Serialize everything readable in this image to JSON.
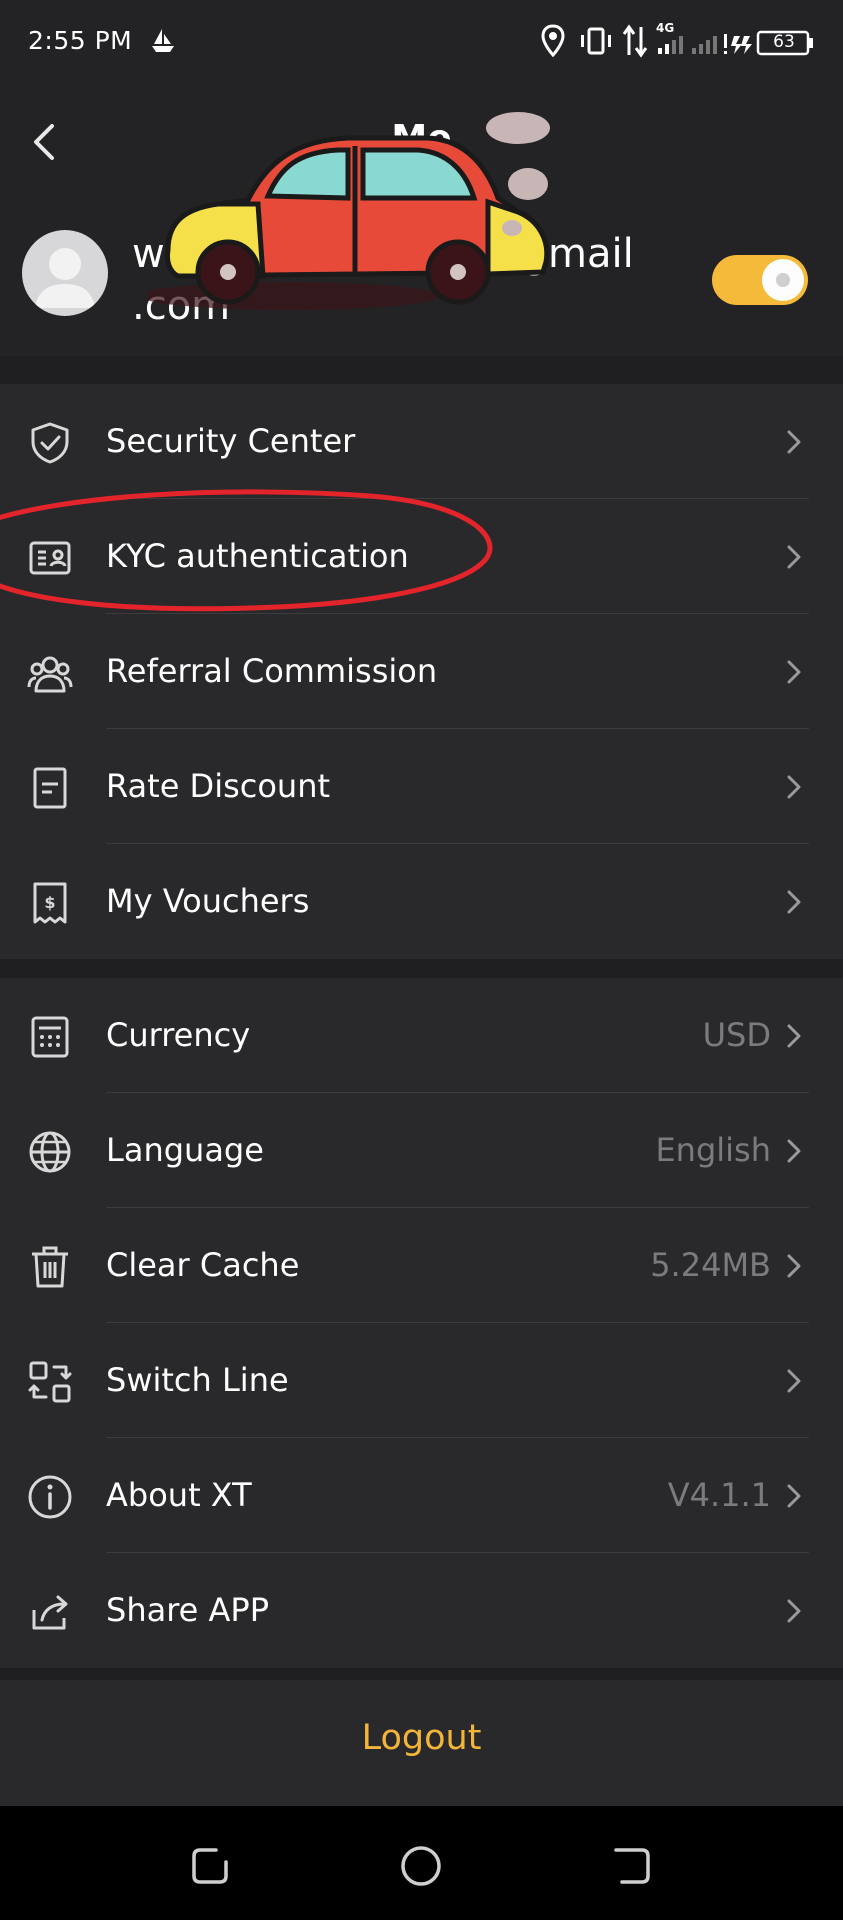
{
  "status_bar": {
    "time": "2:55 PM",
    "network": "4G",
    "battery": "63",
    "icons": [
      "boat-icon",
      "location-icon",
      "vibrate-icon",
      "data-arrows-icon",
      "signal-icon",
      "battery-icon"
    ]
  },
  "header": {
    "title": "Me",
    "email_line1": "w                         @gmail",
    "email_line2": ".com",
    "toggle_on": true,
    "accent_color": "#f6ba3b"
  },
  "menu_group_1": [
    {
      "label": "Security Center",
      "value": "",
      "icon": "shield-check-icon"
    },
    {
      "label": "KYC authentication",
      "value": "",
      "icon": "id-card-icon"
    },
    {
      "label": "Referral Commission",
      "value": "",
      "icon": "users-icon"
    },
    {
      "label": "Rate Discount",
      "value": "",
      "icon": "document-icon"
    },
    {
      "label": "My Vouchers",
      "value": "",
      "icon": "voucher-icon"
    }
  ],
  "menu_group_2": [
    {
      "label": "Currency",
      "value": "USD",
      "icon": "calculator-icon"
    },
    {
      "label": "Language",
      "value": "English",
      "icon": "globe-icon"
    },
    {
      "label": "Clear Cache",
      "value": "5.24MB",
      "icon": "trash-icon"
    },
    {
      "label": "Switch Line",
      "value": "",
      "icon": "switch-icon"
    },
    {
      "label": "About XT",
      "value": "V4.1.1",
      "icon": "info-icon"
    },
    {
      "label": "Share APP",
      "value": "",
      "icon": "share-icon"
    }
  ],
  "logout": {
    "label": "Logout",
    "color": "#f3b43a"
  },
  "nav_bar": {
    "icons": [
      "recents-icon",
      "home-circle-icon",
      "back-nav-icon"
    ]
  },
  "annotation": {
    "color": "#e3242b",
    "shape": "ellipse-around-kyc"
  }
}
